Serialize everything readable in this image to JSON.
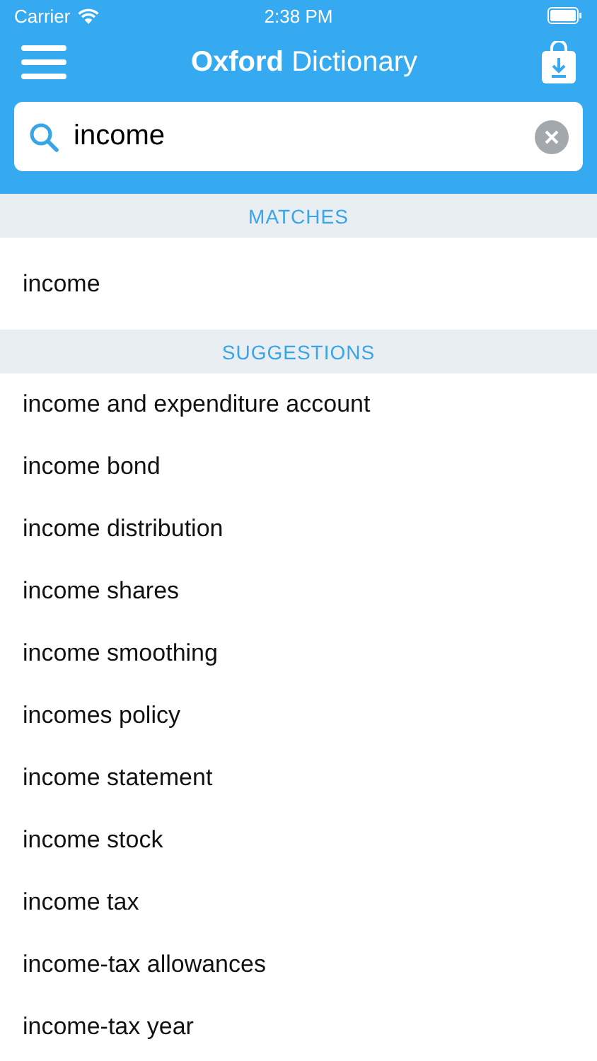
{
  "status_bar": {
    "carrier": "Carrier",
    "time": "2:38 PM"
  },
  "nav": {
    "title": "**Oxford** Dictionary"
  },
  "search": {
    "value": "income"
  },
  "sections": [
    {
      "title": "MATCHES",
      "items": [
        "income"
      ]
    },
    {
      "title": "SUGGESTIONS",
      "items": [
        "income and expenditure account",
        "income bond",
        "income distribution",
        "income shares",
        "income smoothing",
        "incomes policy",
        "income statement",
        "income stock",
        "income tax",
        "income-tax allowances",
        "income-tax year"
      ]
    }
  ]
}
